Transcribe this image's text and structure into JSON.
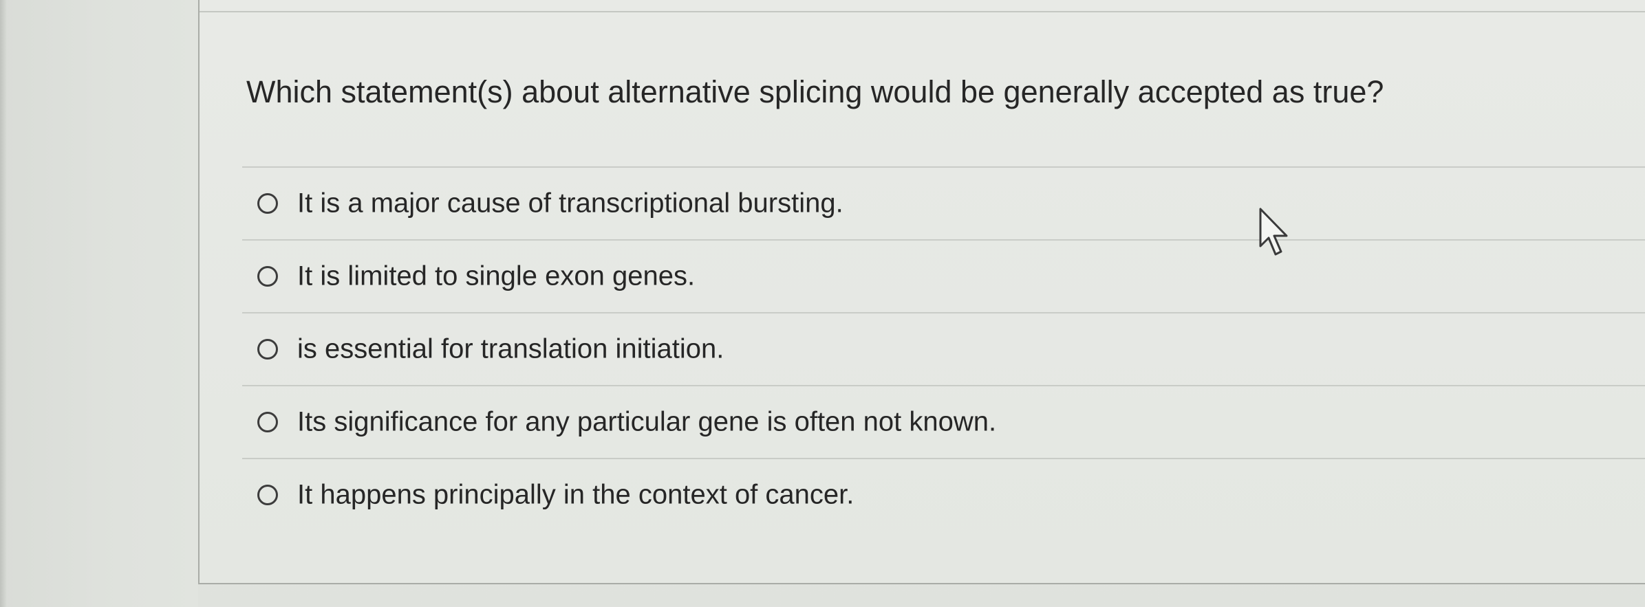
{
  "question": {
    "text": "Which statement(s) about alternative splicing would be generally accepted as true?"
  },
  "options": [
    {
      "label": "It is a major cause of transcriptional bursting.",
      "selected": false
    },
    {
      "label": "It is limited to single exon genes.",
      "selected": false
    },
    {
      "label": "is essential for translation initiation.",
      "selected": false
    },
    {
      "label": "Its significance for any particular gene is often not known.",
      "selected": false
    },
    {
      "label": "It happens principally in the context of cancer.",
      "selected": false
    }
  ],
  "icons": {
    "cursor": "arrow-cursor-icon",
    "radio": "radio-unchecked-icon"
  },
  "colors": {
    "text": "#262626",
    "rule": "#c9ccc7",
    "background": "#e5e7e3"
  }
}
